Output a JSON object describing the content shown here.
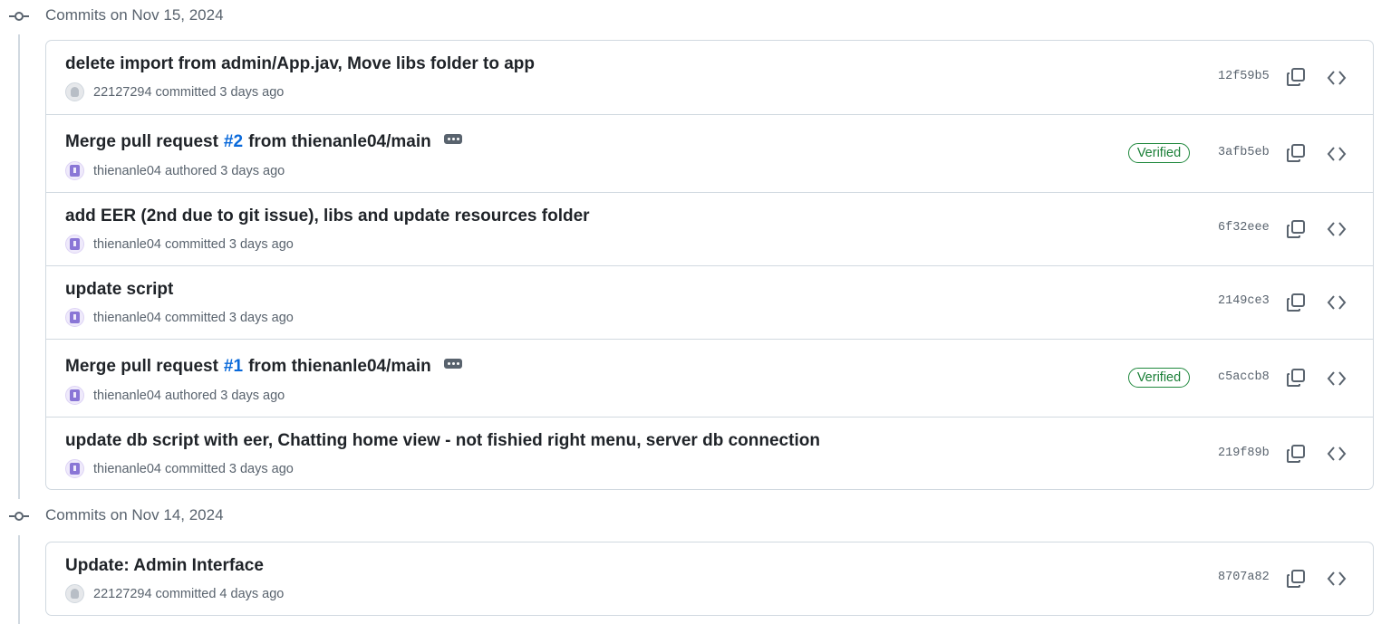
{
  "groups": [
    {
      "date_label": "Commits on Nov 15, 2024",
      "commits": [
        {
          "title": "delete import from admin/App.jav, Move libs folder to app",
          "author": "22127294",
          "verb": "committed",
          "time": "3 days ago",
          "avatar": "github-default-avatar",
          "verified": "",
          "sha": "12f59b5"
        },
        {
          "title_prefix": "Merge pull request",
          "pr_link": "#2",
          "title_suffix": "from thienanle04/main",
          "has_ellipsis": true,
          "author": "thienanle04",
          "verb": "authored",
          "time": "3 days ago",
          "avatar": "user-identicon-avatar",
          "verified": "Verified",
          "sha": "3afb5eb"
        },
        {
          "title": "add EER (2nd due to git issue), libs and update resources folder",
          "author": "thienanle04",
          "verb": "committed",
          "time": "3 days ago",
          "avatar": "user-identicon-avatar",
          "verified": "",
          "sha": "6f32eee"
        },
        {
          "title": "update script",
          "author": "thienanle04",
          "verb": "committed",
          "time": "3 days ago",
          "avatar": "user-identicon-avatar",
          "verified": "",
          "sha": "2149ce3"
        },
        {
          "title_prefix": "Merge pull request",
          "pr_link": "#1",
          "title_suffix": "from thienanle04/main",
          "has_ellipsis": true,
          "author": "thienanle04",
          "verb": "authored",
          "time": "3 days ago",
          "avatar": "user-identicon-avatar",
          "verified": "Verified",
          "sha": "c5accb8"
        },
        {
          "title": "update db script with eer, Chatting home view - not fishied right menu, server db connection",
          "author": "thienanle04",
          "verb": "committed",
          "time": "3 days ago",
          "avatar": "user-identicon-avatar",
          "verified": "",
          "sha": "219f89b"
        }
      ]
    },
    {
      "date_label": "Commits on Nov 14, 2024",
      "commits": [
        {
          "title": "Update: Admin Interface",
          "author": "22127294",
          "verb": "committed",
          "time": "4 days ago",
          "avatar": "github-default-avatar",
          "verified": "",
          "sha": "8707a82"
        }
      ]
    }
  ],
  "icons": {
    "group": "git-commit-icon",
    "copy": "copy-icon",
    "browse": "code-browse-icon",
    "ellipsis": "kebab-ellipsis-icon"
  },
  "colors": {
    "link": "#0969da",
    "verified": "#1a7f37",
    "muted": "#59636e",
    "border": "#d1d9e0"
  }
}
